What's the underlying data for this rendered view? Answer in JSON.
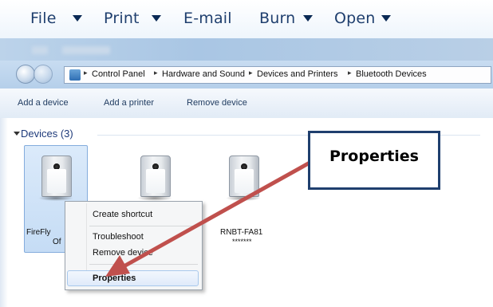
{
  "menu": {
    "file": "File",
    "print": "Print",
    "email": "E-mail",
    "burn": "Burn",
    "open": "Open"
  },
  "breadcrumb": [
    "Control Panel",
    "Hardware and Sound",
    "Devices and Printers",
    "Bluetooth Devices"
  ],
  "commands": {
    "add_device": "Add a device",
    "add_printer": "Add a printer",
    "remove_device": "Remove device"
  },
  "group": {
    "label": "Devices (3)"
  },
  "devices": [
    {
      "label_line1": "FireFly",
      "label_line2": "Of"
    },
    {
      "label_line1": ""
    },
    {
      "label_line1": "RNBT-FA81",
      "label_line2": "*******"
    }
  ],
  "context_menu": {
    "items": [
      "Create shortcut",
      "Troubleshoot",
      "Remove device",
      "Properties"
    ]
  },
  "callout": {
    "text": "Properties"
  },
  "colors": {
    "callout_border": "#1f3f6e",
    "arrow": "#c0504d",
    "selection": "#c5dcf5"
  }
}
